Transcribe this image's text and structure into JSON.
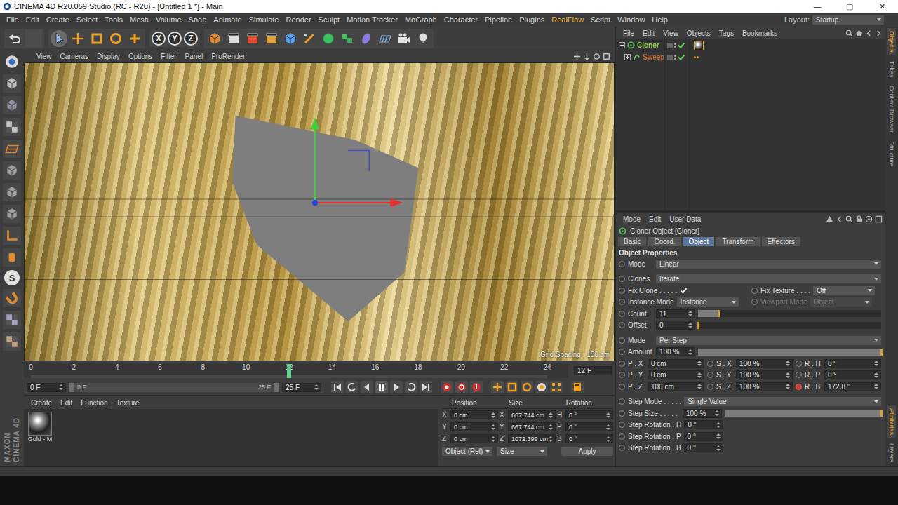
{
  "window": {
    "title": "CINEMA 4D R20.059 Studio (RC - R20) - [Untitled 1 *] - Main",
    "controls": [
      "—",
      "▢",
      "✕"
    ]
  },
  "menu": [
    {
      "label": "File",
      "accent": false
    },
    {
      "label": "Edit",
      "accent": false
    },
    {
      "label": "Create",
      "accent": false
    },
    {
      "label": "Select",
      "accent": false
    },
    {
      "label": "Tools",
      "accent": false
    },
    {
      "label": "Mesh",
      "accent": false
    },
    {
      "label": "Volume",
      "accent": false
    },
    {
      "label": "Snap",
      "accent": false
    },
    {
      "label": "Animate",
      "accent": false
    },
    {
      "label": "Simulate",
      "accent": false
    },
    {
      "label": "Render",
      "accent": false
    },
    {
      "label": "Sculpt",
      "accent": false
    },
    {
      "label": "Motion Tracker",
      "accent": false
    },
    {
      "label": "MoGraph",
      "accent": false
    },
    {
      "label": "Character",
      "accent": false
    },
    {
      "label": "Pipeline",
      "accent": false
    },
    {
      "label": "Plugins",
      "accent": false
    },
    {
      "label": "RealFlow",
      "accent": true
    },
    {
      "label": "Script",
      "accent": false
    },
    {
      "label": "Window",
      "accent": false
    },
    {
      "label": "Help",
      "accent": false
    }
  ],
  "layout": {
    "label": "Layout:",
    "value": "Startup"
  },
  "toolbar": {
    "axis_locks": [
      "X",
      "Y",
      "Z"
    ]
  },
  "left_tools": {
    "snap_label": "S"
  },
  "viewport": {
    "menu": [
      "View",
      "Cameras",
      "Display",
      "Options",
      "Filter",
      "Panel",
      "ProRender"
    ],
    "grid_spacing": "Grid Spacing : 100 cm"
  },
  "timeline": {
    "ticks": [
      "0",
      "2",
      "4",
      "6",
      "8",
      "10",
      "12",
      "14",
      "16",
      "18",
      "20",
      "22",
      "24"
    ],
    "playhead": 0.5,
    "current_frame": "12 F"
  },
  "transport": {
    "start": "0 F",
    "range_start": "0 F",
    "range_end": "25 F",
    "end": "25 F",
    "playing": true
  },
  "materials": {
    "menu": [
      "Create",
      "Edit",
      "Function",
      "Texture"
    ],
    "items": [
      {
        "name": "Gold - M",
        "selected": false
      }
    ]
  },
  "coordinates": {
    "headers": [
      "Position",
      "Size",
      "Rotation"
    ],
    "rows": [
      {
        "axis": "X",
        "position": "0 cm",
        "size_axis": "X",
        "size": "667.744 cm",
        "rot_axis": "H",
        "rotation": "0 °"
      },
      {
        "axis": "Y",
        "position": "0 cm",
        "size_axis": "Y",
        "size": "667.744 cm",
        "rot_axis": "P",
        "rotation": "0 °"
      },
      {
        "axis": "Z",
        "position": "0 cm",
        "size_axis": "Z",
        "size": "1072.399 cm",
        "rot_axis": "B",
        "rotation": "0 °"
      }
    ],
    "mode": "Object (Rel)",
    "size_mode": "Size",
    "apply": "Apply"
  },
  "object_manager": {
    "menu": [
      "File",
      "Edit",
      "View",
      "Objects",
      "Tags",
      "Bookmarks"
    ],
    "objects": [
      {
        "name": "Cloner",
        "expanded": true,
        "depth": 0,
        "color": "#8fd14f",
        "has_tag": true,
        "selected": true
      },
      {
        "name": "Sweep",
        "expanded": false,
        "depth": 1,
        "color": "#e0782a",
        "has_tag": false,
        "selected": false
      }
    ]
  },
  "side_tabs_top": [
    {
      "label": "Objects",
      "selected": true
    },
    {
      "label": "Takes",
      "selected": false
    },
    {
      "label": "Content Browser",
      "selected": false
    },
    {
      "label": "Structure",
      "selected": false
    }
  ],
  "side_tabs_bottom": [
    {
      "label": "Attributes",
      "selected": true
    },
    {
      "label": "Layers",
      "selected": false
    }
  ],
  "attributes": {
    "menu": [
      "Mode",
      "Edit",
      "User Data"
    ],
    "title": "Cloner Object [Cloner]",
    "tabs": [
      {
        "label": "Basic",
        "selected": false
      },
      {
        "label": "Coord.",
        "selected": false
      },
      {
        "label": "Object",
        "selected": true
      },
      {
        "label": "Transform",
        "selected": false
      },
      {
        "label": "Effectors",
        "selected": false
      }
    ],
    "section": "Object Properties",
    "groups": [
      [
        {
          "kind": "dropdown",
          "label": "Mode",
          "value": "Linear"
        }
      ],
      [
        {
          "kind": "dropdown",
          "label": "Clones",
          "value": "Iterate"
        },
        {
          "kind": "check",
          "label": "Fix Clone . . . . .",
          "checked": true,
          "label2": "Fix Texture . . . .",
          "value2": "Off"
        },
        {
          "kind": "pair",
          "label": "Instance Mode",
          "value": "Instance",
          "label2": "Viewport Mode",
          "value2": "Object",
          "disabled2": true
        },
        {
          "kind": "slider",
          "label": "Count",
          "value": "11",
          "level": 0.11
        },
        {
          "kind": "slider",
          "label": "Offset",
          "value": "0",
          "level": 0
        }
      ],
      [
        {
          "kind": "dropdown",
          "label": "Mode",
          "value": "Per Step"
        },
        {
          "kind": "slider",
          "label": "Amount",
          "value": "100 %",
          "level": 1
        },
        {
          "kind": "triple",
          "cells": [
            {
              "label": "P . X",
              "value": "0 cm",
              "keyed": false
            },
            {
              "label": "S . X",
              "value": "100 %",
              "keyed": false
            },
            {
              "label": "R . H",
              "value": "0 °",
              "keyed": false
            }
          ]
        },
        {
          "kind": "triple",
          "cells": [
            {
              "label": "P . Y",
              "value": "0 cm",
              "keyed": false
            },
            {
              "label": "S . Y",
              "value": "100 %",
              "keyed": false
            },
            {
              "label": "R . P",
              "value": "0 °",
              "keyed": false
            }
          ]
        },
        {
          "kind": "triple",
          "cells": [
            {
              "label": "P . Z",
              "value": "100 cm",
              "keyed": false
            },
            {
              "label": "S . Z",
              "value": "100 %",
              "keyed": false
            },
            {
              "label": "R . B",
              "value": "172.8 °",
              "keyed": true
            }
          ]
        }
      ],
      [
        {
          "kind": "dropdown",
          "label": "Step Mode . . . . .",
          "value": "Single Value"
        },
        {
          "kind": "slider",
          "label": "Step Size . . . . .",
          "value": "100 %",
          "level": 1
        },
        {
          "kind": "spin",
          "label": "Step Rotation . H",
          "value": "0 °"
        },
        {
          "kind": "spin",
          "label": "Step Rotation . P",
          "value": "0 °"
        },
        {
          "kind": "spin",
          "label": "Step Rotation . B",
          "value": "0 °"
        }
      ]
    ]
  },
  "branding": {
    "lines": [
      "MAXON",
      "CINEMA 4D"
    ]
  }
}
